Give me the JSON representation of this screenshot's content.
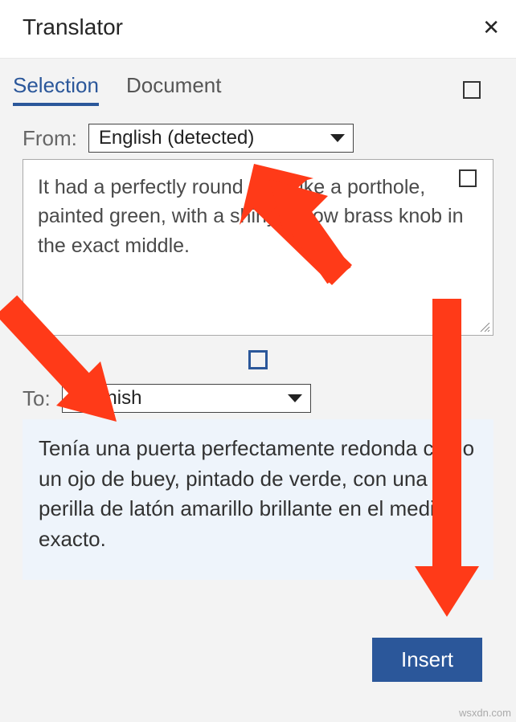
{
  "header": {
    "title": "Translator"
  },
  "tabs": {
    "selection": "Selection",
    "document": "Document"
  },
  "fromRow": {
    "label": "From:",
    "value": "English (detected)"
  },
  "sourceText": "It had a perfectly round door like a porthole, painted green, with a shiny yellow brass knob in the exact middle.",
  "toRow": {
    "label": "To:",
    "value": "Spanish"
  },
  "targetText": "Tenía una puerta perfectamente redonda como un ojo de buey, pintado de verde, con una perilla de latón amarillo brillante en el medio exacto.",
  "buttons": {
    "insert": "Insert"
  },
  "watermark": "wsxdn.com",
  "colors": {
    "accent": "#2b579a",
    "arrow": "#ff3a18"
  }
}
